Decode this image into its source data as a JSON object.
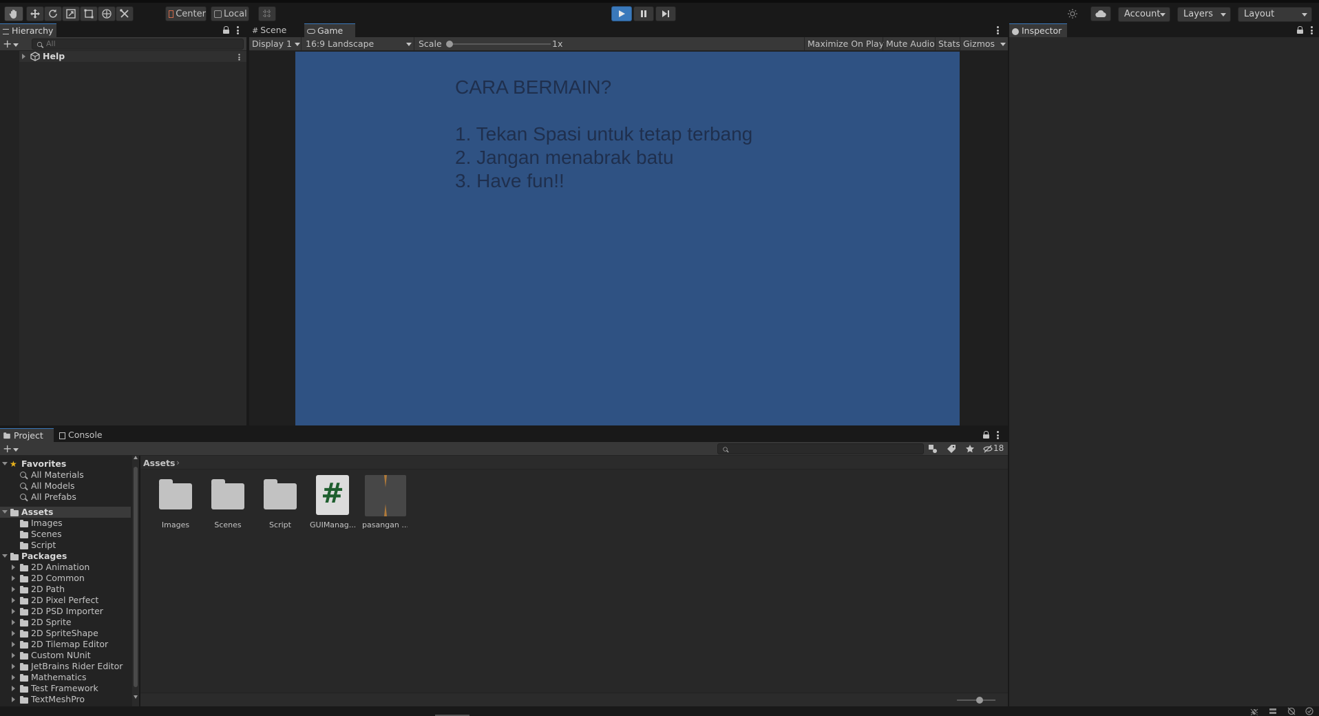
{
  "toolbar": {
    "tools": [
      "hand-tool-icon",
      "move-tool-icon",
      "rotate-tool-icon",
      "scale-tool-icon",
      "rect-tool-icon",
      "transform-tool-icon",
      "custom-tool-icon"
    ],
    "pivot_mode": "Center",
    "pivot_rotation": "Local",
    "account_label": "Account",
    "layers_label": "Layers",
    "layout_label": "Layout"
  },
  "hierarchy": {
    "tab_label": "Hierarchy",
    "search_placeholder": "All",
    "items": [
      {
        "label": "Help"
      }
    ]
  },
  "scene_view": {
    "tabs": [
      {
        "label": "Scene"
      },
      {
        "label": "Game"
      }
    ],
    "display": "Display 1",
    "aspect": "16:9 Landscape",
    "scale_label": "Scale",
    "scale_value": "1x",
    "maximize_label": "Maximize On Play",
    "mute_label": "Mute Audio",
    "stats_label": "Stats",
    "gizmos_label": "Gizmos"
  },
  "game": {
    "title": "CARA BERMAIN?",
    "lines": [
      "1. Tekan Spasi untuk tetap terbang",
      "2. Jangan menabrak batu",
      "3. Have fun!!"
    ],
    "background_color": "#2f5283",
    "text_color": "#1f2f4d"
  },
  "inspector": {
    "tab_label": "Inspector"
  },
  "project": {
    "tabs": [
      {
        "label": "Project"
      },
      {
        "label": "Console"
      }
    ],
    "hidden_count": "18",
    "breadcrumb": "Assets",
    "favorites": {
      "label": "Favorites",
      "items": [
        "All Materials",
        "All Models",
        "All Prefabs"
      ]
    },
    "assets": {
      "label": "Assets",
      "items": [
        "Images",
        "Scenes",
        "Script"
      ]
    },
    "packages": {
      "label": "Packages",
      "items": [
        "2D Animation",
        "2D Common",
        "2D Path",
        "2D Pixel Perfect",
        "2D PSD Importer",
        "2D Sprite",
        "2D SpriteShape",
        "2D Tilemap Editor",
        "Custom NUnit",
        "JetBrains Rider Editor",
        "Mathematics",
        "Test Framework",
        "TextMeshPro"
      ]
    },
    "grid_items": [
      {
        "name": "Images",
        "kind": "folder"
      },
      {
        "name": "Scenes",
        "kind": "folder"
      },
      {
        "name": "Script",
        "kind": "folder"
      },
      {
        "name": "GUIManag...",
        "kind": "script",
        "glyph": "#"
      },
      {
        "name": "pasangan ...",
        "kind": "sprite"
      }
    ]
  },
  "colors": {
    "accent": "#3a79bb",
    "play_active": "#3a79bb",
    "panel": "#282828",
    "toolbar": "#191919"
  }
}
